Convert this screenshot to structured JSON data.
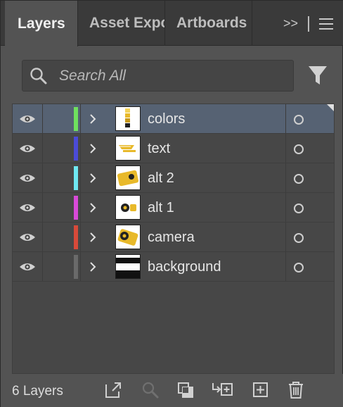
{
  "tabs": [
    {
      "label": "Layers",
      "active": true
    },
    {
      "label": "Asset Expo"
    },
    {
      "label": "Artboards"
    }
  ],
  "tabbar": {
    "overflow_label": ">>"
  },
  "search": {
    "placeholder": "Search All",
    "value": ""
  },
  "layers": [
    {
      "name": "colors",
      "color": "#6fe05e",
      "selected": true,
      "visible": true
    },
    {
      "name": "text",
      "color": "#4b4bd8",
      "selected": false,
      "visible": true
    },
    {
      "name": "alt 2",
      "color": "#6fe8f2",
      "selected": false,
      "visible": true
    },
    {
      "name": "alt 1",
      "color": "#d94ad9",
      "selected": false,
      "visible": true
    },
    {
      "name": "camera",
      "color": "#d84a3a",
      "selected": false,
      "visible": true
    },
    {
      "name": "background",
      "color": "#6a6a6a",
      "selected": false,
      "visible": true
    }
  ],
  "footer": {
    "layer_count": "6 Layers"
  },
  "icons": {
    "visibility": "eye-icon",
    "expand": "chevron-right-icon",
    "target": "target-circle-icon",
    "filter": "filter-icon",
    "search": "search-icon",
    "footer": [
      "export-icon",
      "locate-object-icon",
      "clipping-mask-icon",
      "new-sublayer-icon",
      "new-layer-icon",
      "trash-icon"
    ]
  },
  "colors": {
    "accent_selected_row": "#566273",
    "panel": "#535353"
  }
}
